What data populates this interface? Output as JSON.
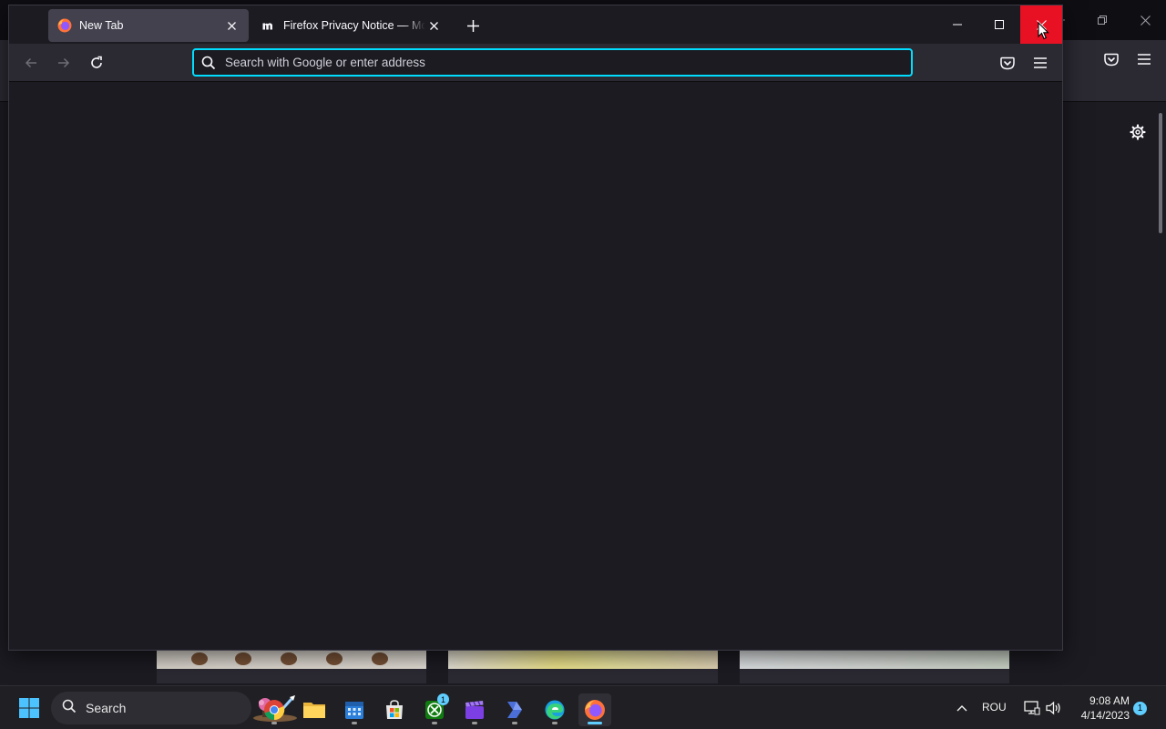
{
  "browser": {
    "tabs": [
      {
        "title": "New Tab",
        "favicon": "firefox-icon",
        "active": true
      },
      {
        "title": "Firefox Privacy Notice — Mozilla",
        "favicon": "mozilla-m-icon",
        "active": false
      }
    ],
    "urlbar": {
      "placeholder": "Search with Google or enter address",
      "value": ""
    },
    "icons": {
      "back": "back-arrow-icon",
      "forward": "forward-arrow-icon",
      "reload": "reload-icon",
      "pocket": "pocket-icon",
      "menu": "hamburger-menu-icon",
      "new_tab": "plus-icon",
      "settings": "gear-icon"
    }
  },
  "taskbar": {
    "search_label": "Search",
    "apps": [
      {
        "name": "Chrome",
        "icon": "chrome-icon"
      },
      {
        "name": "File Explorer",
        "icon": "folder-icon"
      },
      {
        "name": "Calendar",
        "icon": "calendar-icon"
      },
      {
        "name": "Microsoft Store",
        "icon": "store-icon"
      },
      {
        "name": "Xbox",
        "icon": "xbox-icon",
        "badge": "1"
      },
      {
        "name": "Clipchamp",
        "icon": "clapperboard-icon"
      },
      {
        "name": "Power Automate",
        "icon": "power-automate-icon"
      },
      {
        "name": "Edge",
        "icon": "edge-icon"
      },
      {
        "name": "Firefox",
        "icon": "firefox-icon",
        "active": true
      }
    ],
    "tray": {
      "language": "ROU",
      "time": "9:08 AM",
      "date": "4/14/2023",
      "notifications": "1"
    }
  },
  "colors": {
    "accent": "#00ddff",
    "close_hover": "#e81123",
    "window_bg": "#1c1b22",
    "toolbar_bg": "#2b2a33"
  }
}
